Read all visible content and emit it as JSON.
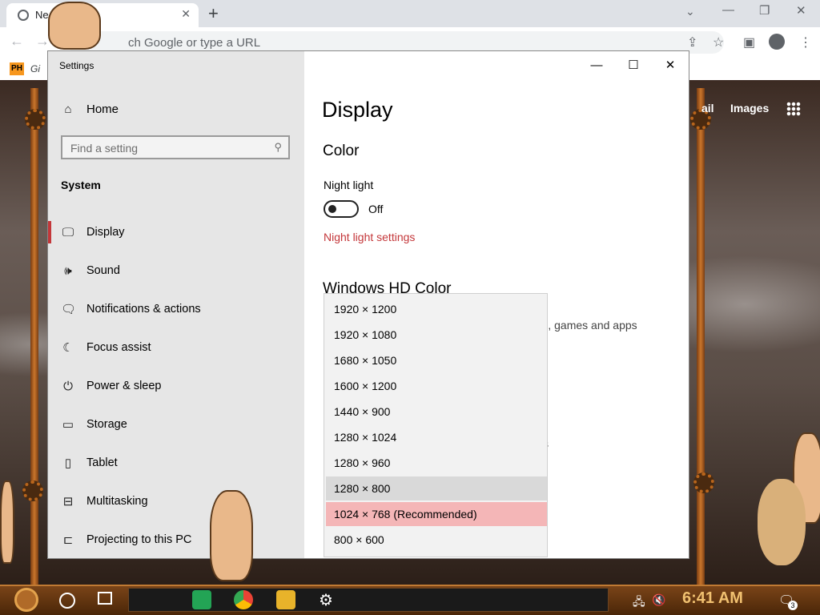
{
  "browser": {
    "tab_title": "Ne",
    "tab_close": "✕",
    "new_tab": "+",
    "tab_chevron": "⌄",
    "win_min": "—",
    "win_restore": "❐",
    "win_close": "✕",
    "back": "←",
    "forward": "→",
    "omnibox_placeholder": "ch Google or type a URL",
    "bookmark_badge": "PH",
    "bookmark_text": "Gi"
  },
  "google": {
    "gmail_fragment": "ail",
    "images": "Images"
  },
  "settings": {
    "window_title": "Settings",
    "title_buttons": {
      "minimize": "—",
      "maximize": "☐",
      "close": "✕"
    },
    "sidebar": {
      "home_label": "Home",
      "search_placeholder": "Find a setting",
      "section": "System",
      "items": [
        {
          "label": "Display",
          "icon": "monitor-icon",
          "glyph": "🖵",
          "active": true
        },
        {
          "label": "Sound",
          "icon": "speaker-icon",
          "glyph": "🕪",
          "active": false
        },
        {
          "label": "Notifications & actions",
          "icon": "notification-icon",
          "glyph": "🗨",
          "active": false
        },
        {
          "label": "Focus assist",
          "icon": "moon-icon",
          "glyph": "☾",
          "active": false
        },
        {
          "label": "Power & sleep",
          "icon": "power-icon",
          "glyph": "⏻",
          "active": false
        },
        {
          "label": "Storage",
          "icon": "storage-icon",
          "glyph": "▭",
          "active": false
        },
        {
          "label": "Tablet",
          "icon": "tablet-icon",
          "glyph": "▯",
          "active": false
        },
        {
          "label": "Multitasking",
          "icon": "multitasking-icon",
          "glyph": "⊟",
          "active": false
        },
        {
          "label": "Projecting to this PC",
          "icon": "projecting-icon",
          "glyph": "⊏",
          "active": false
        }
      ]
    },
    "content": {
      "page_title": "Display",
      "color_heading": "Color",
      "night_light_label": "Night light",
      "night_light_state": "Off",
      "night_light_link": "Night light settings",
      "hdr_heading": "Windows HD Color",
      "hdr_description_fragment": "deos, games and apps",
      "fragment_char": "s"
    },
    "resolution_dropdown": {
      "options": [
        "1920 × 1200",
        "1920 × 1080",
        "1680 × 1050",
        "1600 × 1200",
        "1440 × 900",
        "1280 × 1024",
        "1280 × 960",
        "1280 × 800",
        "1024 × 768 (Recommended)",
        "800 × 600"
      ],
      "hovered_index": 7,
      "selected_index": 8,
      "selected_color": "#f4b6b7"
    }
  },
  "taskbar": {
    "clock": "6:41 AM",
    "notification_count": "3",
    "tray": {
      "network": "🖧",
      "volume": "🔇"
    }
  },
  "colors": {
    "accent": "#c4373a",
    "sidebar_bg": "#e6e6e6",
    "taskbar": "#7a4418"
  }
}
